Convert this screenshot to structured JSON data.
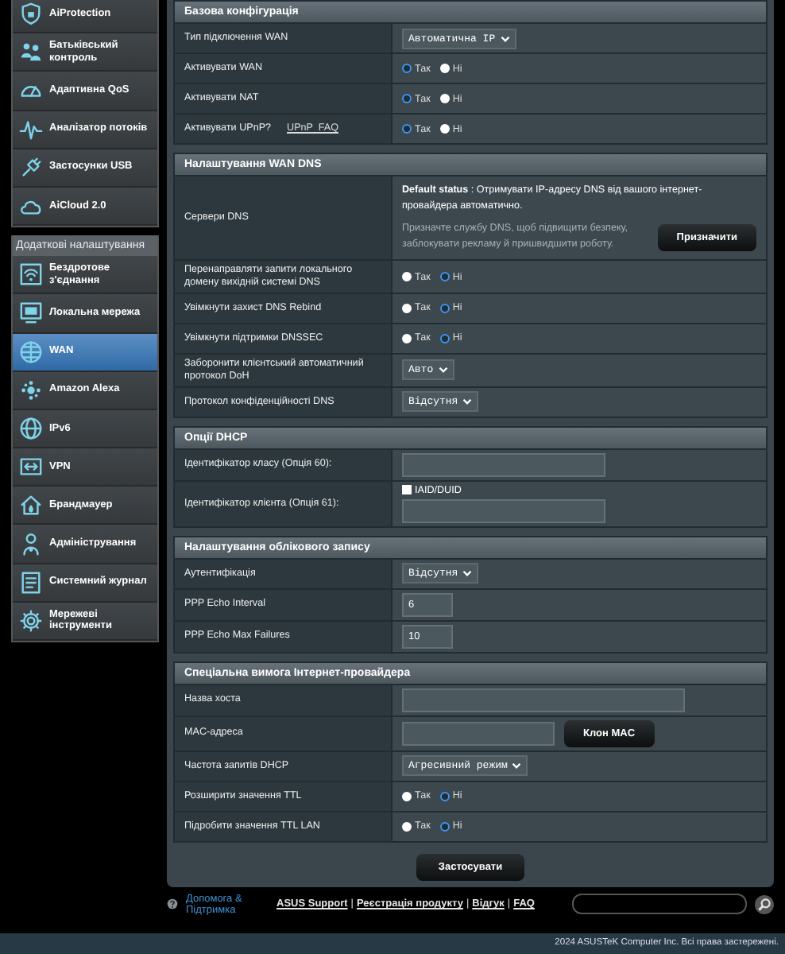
{
  "sidebar": {
    "groups": [
      {
        "items": [
          {
            "label": "AiProtection",
            "selected": false
          },
          {
            "label": "Батьківський контроль",
            "selected": false
          },
          {
            "label": "Адаптивна QoS",
            "selected": false
          },
          {
            "label": "Аналізатор потоків",
            "selected": false
          },
          {
            "label": "Застосунки USB",
            "selected": false
          },
          {
            "label": "AiCloud 2.0",
            "selected": false
          }
        ]
      },
      {
        "title": "Додаткові налаштування",
        "items": [
          {
            "label": "Бездротове з'єднання",
            "selected": false
          },
          {
            "label": "Локальна мережа",
            "selected": false
          },
          {
            "label": "WAN",
            "selected": true
          },
          {
            "label": "Amazon Alexa",
            "selected": false
          },
          {
            "label": "IPv6",
            "selected": false
          },
          {
            "label": "VPN",
            "selected": false
          },
          {
            "label": "Брандмауер",
            "selected": false
          },
          {
            "label": "Адміністрування",
            "selected": false
          },
          {
            "label": "Системний журнал",
            "selected": false
          },
          {
            "label": "Мережеві інструменти",
            "selected": false
          }
        ]
      }
    ]
  },
  "sections": [
    {
      "title": "Базова конфігурація",
      "rows": [
        {
          "label": "Тип підключення WAN",
          "kind": "select",
          "value": "Автоматична IP"
        },
        {
          "label": "Активувати WAN",
          "kind": "radio",
          "options": [
            {
              "label": "Так",
              "selected": true
            },
            {
              "label": "Ні",
              "selected": false
            }
          ]
        },
        {
          "label": "Активувати NAT",
          "kind": "radio",
          "options": [
            {
              "label": "Так",
              "selected": true
            },
            {
              "label": "Ні",
              "selected": false
            }
          ]
        },
        {
          "label": "Активувати UPnP?",
          "link": "UPnP  FAQ",
          "kind": "radio",
          "options": [
            {
              "label": "Так",
              "selected": true
            },
            {
              "label": "Ні",
              "selected": false
            }
          ]
        }
      ]
    },
    {
      "title": "Налаштування WAN DNS",
      "rows": [
        {
          "label": "Сервери DNS",
          "kind": "dns",
          "status": "**Default status** : Отримувати IP-адресу DNS від вашого інтернет-провайдера автоматично.",
          "note": "Призначте службу DNS, щоб підвищити безпеку, заблокувати рекламу й пришвидшити роботу.",
          "button": "Призначити"
        },
        {
          "label": "Перенаправляти запити локального домену вихідній системі DNS",
          "kind": "radio",
          "options": [
            {
              "label": "Так",
              "selected": false
            },
            {
              "label": "Ні",
              "selected": true
            }
          ]
        },
        {
          "label": "Увімкнути захист DNS Rebind",
          "kind": "radio",
          "options": [
            {
              "label": "Так",
              "selected": false
            },
            {
              "label": "Ні",
              "selected": true
            }
          ]
        },
        {
          "label": "Увімкнути підтримки DNSSEC",
          "kind": "radio",
          "options": [
            {
              "label": "Так",
              "selected": false
            },
            {
              "label": "Ні",
              "selected": true
            }
          ]
        },
        {
          "label": "Заборонити клієнтський автоматичний протокол DoH",
          "kind": "select",
          "value": "Авто"
        },
        {
          "label": "Протокол конфіденційності DNS",
          "kind": "select",
          "value": "Відсутня"
        }
      ]
    },
    {
      "title": "Опції DHCP",
      "rows": [
        {
          "label": "Ідентифікатор класу (Опція 60):",
          "kind": "input"
        },
        {
          "label": "Ідентифікатор клієнта (Опція 61):",
          "kind": "input",
          "checkbox": {
            "label": "IAID/DUID",
            "checked": false
          }
        }
      ]
    },
    {
      "title": "Налаштування облікового запису",
      "rows": [
        {
          "label": "Аутентифікація",
          "kind": "select",
          "value": "Відсутня"
        },
        {
          "label": "PPP Echo Interval",
          "kind": "number",
          "value": "6"
        },
        {
          "label": "PPP Echo Max Failures",
          "kind": "number",
          "value": "10"
        }
      ]
    },
    {
      "title": "Спеціальна вимога Інтернет-провайдера",
      "rows": [
        {
          "label": "Назва хоста",
          "kind": "input"
        },
        {
          "label": "MAC-адреса",
          "kind": "inputbutton",
          "button": "Клон MAC"
        },
        {
          "label": "Частота запитів DHCP",
          "kind": "select",
          "value": "Агресивний режим"
        },
        {
          "label": "Розширити значення TTL",
          "kind": "radio",
          "options": [
            {
              "label": "Так",
              "selected": false
            },
            {
              "label": "Ні",
              "selected": true
            }
          ]
        },
        {
          "label": "Підробити значення TTL LAN",
          "kind": "radio",
          "options": [
            {
              "label": "Так",
              "selected": false
            },
            {
              "label": "Ні",
              "selected": true
            }
          ]
        }
      ]
    }
  ],
  "apply_button": "Застосувати",
  "footer": {
    "help": "Допомога & Підтримка",
    "links": [
      "ASUS Support",
      "Реєстрація продукту",
      "Відгук",
      "FAQ"
    ],
    "separator": "|",
    "copyright": "2024 ASUSTeK Computer Inc. Всі права застережені."
  }
}
